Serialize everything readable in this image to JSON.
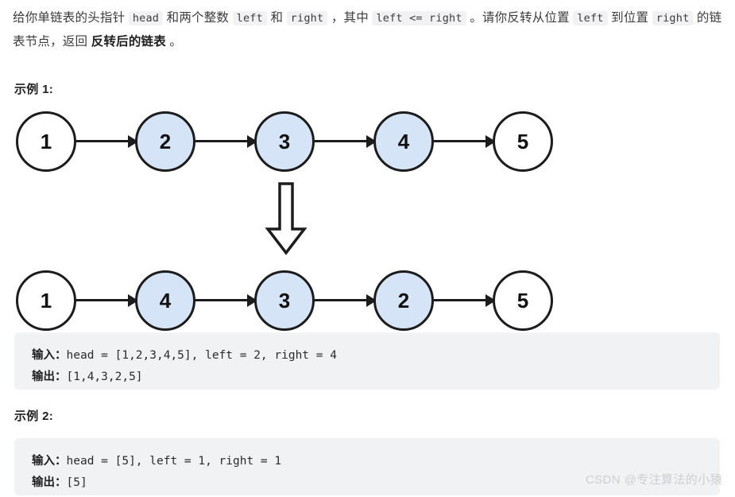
{
  "statement": {
    "part1": "给你单链表的头指针 ",
    "code_head": "head",
    "part2": " 和两个整数 ",
    "code_left": "left",
    "part3": " 和 ",
    "code_right": "right",
    "part4": " ，其中 ",
    "code_cond": "left <= right",
    "part5": " 。请你反转从位置 ",
    "code_left2": "left",
    "part6": " 到位置 ",
    "code_right2": "right",
    "part7": " 的链表节点，返回 ",
    "emphasis": "反转后的链表",
    "part8": " 。"
  },
  "examples": [
    {
      "heading": "示例 1:",
      "input_label": "输入：",
      "input_value": "head = [1,2,3,4,5], left = 2, right = 4",
      "output_label": "输出：",
      "output_value": "[1,4,3,2,5]"
    },
    {
      "heading": "示例 2:",
      "input_label": "输入：",
      "input_value": "head = [5], left = 1, right = 1",
      "output_label": "输出：",
      "output_value": "[5]"
    }
  ],
  "diagram": {
    "before_label": "before-linked-list",
    "after_label": "after-linked-list",
    "transform_icon": "down-arrow-icon",
    "before_nodes": [
      {
        "value": "1",
        "highlighted": false
      },
      {
        "value": "2",
        "highlighted": true
      },
      {
        "value": "3",
        "highlighted": true
      },
      {
        "value": "4",
        "highlighted": true
      },
      {
        "value": "5",
        "highlighted": false
      }
    ],
    "after_nodes": [
      {
        "value": "1",
        "highlighted": false
      },
      {
        "value": "4",
        "highlighted": true
      },
      {
        "value": "3",
        "highlighted": true
      },
      {
        "value": "2",
        "highlighted": true
      },
      {
        "value": "5",
        "highlighted": false
      }
    ],
    "node_fill_highlight": "#d6e4f7",
    "node_fill_plain": "#ffffff",
    "node_stroke": "#1c1c1c"
  },
  "watermark": {
    "text": "CSDN @专注算法的小猿"
  },
  "colors": {
    "code_block_bg": "#f1f2f4",
    "inline_code_bg": "#f2f2f4",
    "body_text": "#3c3c3c"
  }
}
